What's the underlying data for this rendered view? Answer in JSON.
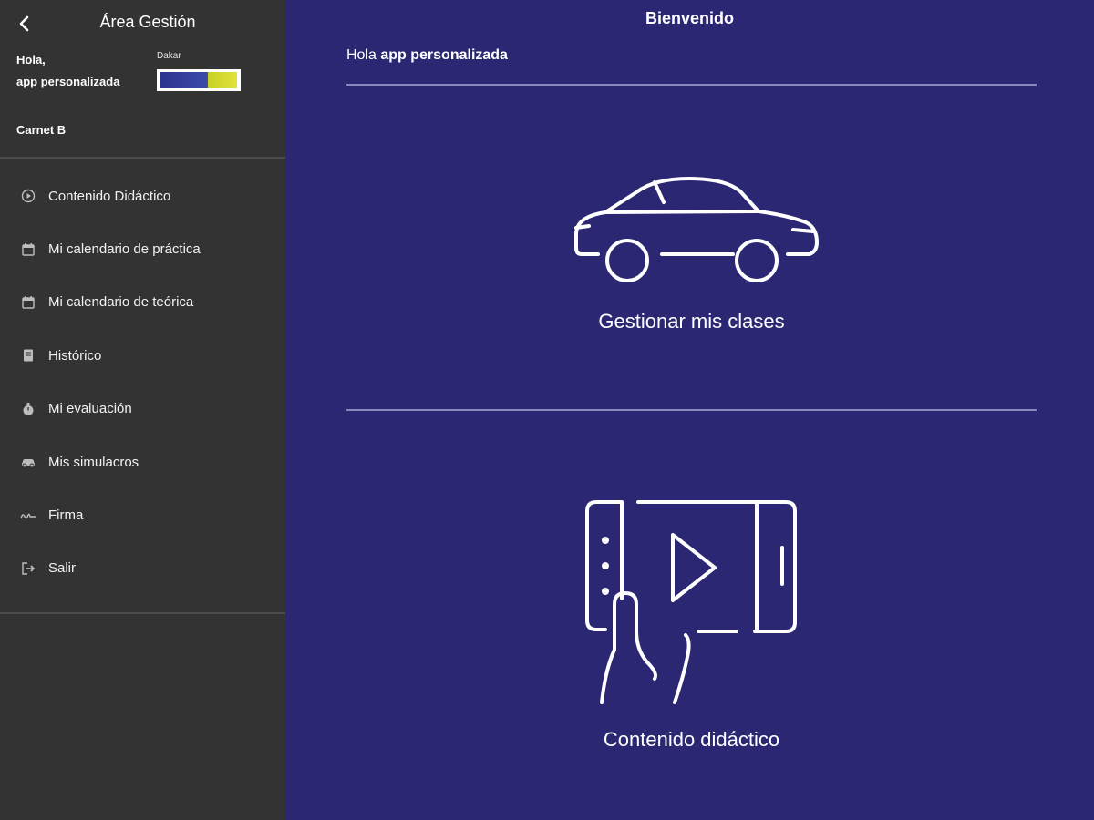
{
  "sidebar": {
    "title": "Área Gestión",
    "greeting": "Hola,",
    "user_name": "app personalizada",
    "license": "Carnet B",
    "school_name": "Dakar",
    "items": [
      {
        "label": "Contenido Didáctico",
        "icon": "play-circle-icon"
      },
      {
        "label": "Mi calendario de práctica",
        "icon": "calendar-icon"
      },
      {
        "label": "Mi calendario de teórica",
        "icon": "calendar-icon"
      },
      {
        "label": "Histórico",
        "icon": "book-icon"
      },
      {
        "label": "Mi evaluación",
        "icon": "stopwatch-icon"
      },
      {
        "label": "Mis simulacros",
        "icon": "car-icon"
      },
      {
        "label": "Firma",
        "icon": "signature-icon"
      },
      {
        "label": "Salir",
        "icon": "logout-icon"
      }
    ]
  },
  "main": {
    "title": "Bienvenido",
    "hello_word": "Hola",
    "hello_name": "app personalizada",
    "cards": [
      {
        "label": "Gestionar mis clases",
        "icon": "car-outline-icon"
      },
      {
        "label": "Contenido didáctico",
        "icon": "tablet-video-icon"
      }
    ]
  },
  "colors": {
    "sidebar_bg": "#333333",
    "main_bg": "#2b2773",
    "accent_yellow": "#e1e33a"
  }
}
